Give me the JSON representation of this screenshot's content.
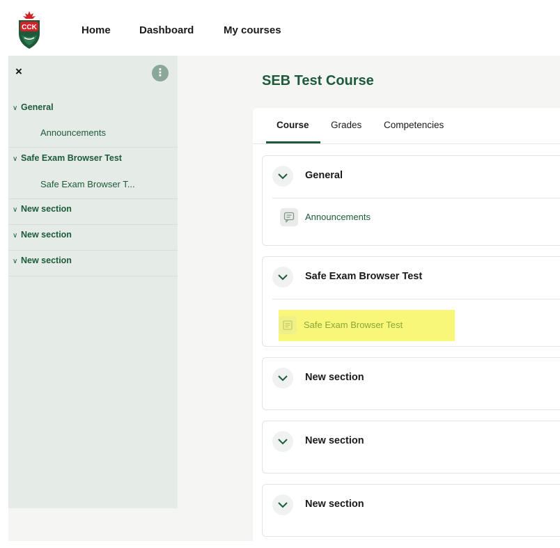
{
  "brand": {
    "logo_text": "CCK"
  },
  "nav": {
    "home": "Home",
    "dashboard": "Dashboard",
    "my_courses": "My courses"
  },
  "drawer": {
    "close_icon": "×",
    "menu_icon": "⋮",
    "sections": [
      {
        "label": "General",
        "items": [
          "Announcements"
        ]
      },
      {
        "label": "Safe Exam Browser Test",
        "items": [
          "Safe Exam Browser T..."
        ]
      },
      {
        "label": "New section",
        "items": []
      },
      {
        "label": "New section",
        "items": []
      },
      {
        "label": "New section",
        "items": []
      }
    ]
  },
  "course": {
    "title": "SEB Test Course"
  },
  "tabs": {
    "course": "Course",
    "grades": "Grades",
    "competencies": "Competencies",
    "active": "Course"
  },
  "sections": [
    {
      "title": "General",
      "activities": [
        {
          "label": "Announcements",
          "icon": "forum-icon",
          "highlighted": false
        }
      ]
    },
    {
      "title": "Safe Exam Browser Test",
      "activities": [
        {
          "label": "Safe Exam Browser Test",
          "icon": "quiz-icon",
          "highlighted": true
        }
      ]
    },
    {
      "title": "New section",
      "activities": []
    },
    {
      "title": "New section",
      "activities": []
    },
    {
      "title": "New section",
      "activities": []
    }
  ],
  "colors": {
    "brand_green": "#1d5a3a",
    "drawer_bg": "#e5ebe7",
    "highlight": "#f8f77a",
    "logo_red": "#d32128"
  }
}
